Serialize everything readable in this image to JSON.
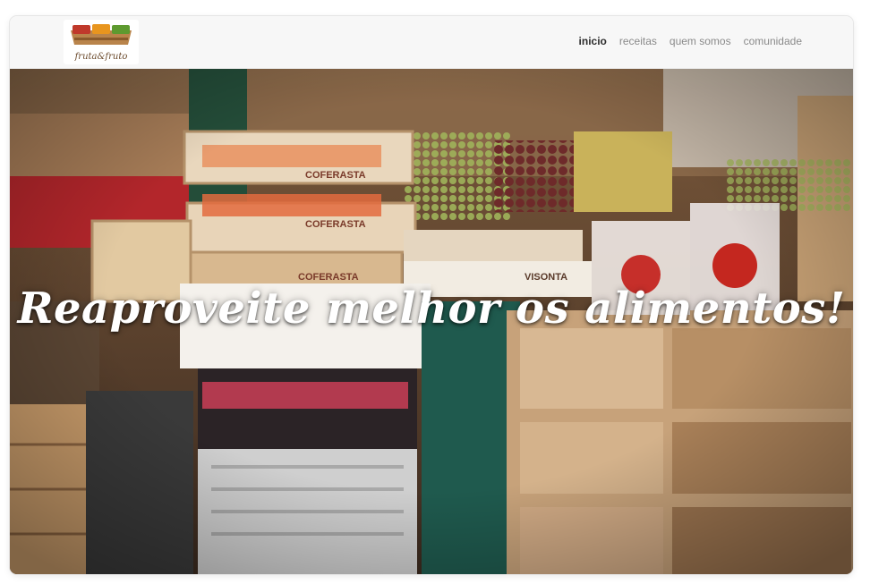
{
  "brand": {
    "logo_text": "fruta&fruto",
    "colors": {
      "wood": "#b9844b",
      "red": "#c0392b",
      "orange": "#e8951e",
      "green": "#5e9a2f"
    }
  },
  "nav": {
    "items": [
      {
        "label": "inicio",
        "active": true
      },
      {
        "label": "receitas",
        "active": false
      },
      {
        "label": "quem somos",
        "active": false
      },
      {
        "label": "comunidade",
        "active": false
      }
    ]
  },
  "hero": {
    "headline": "Reaproveite melhor os alimentos!",
    "crate_labels": [
      "COFERASTA",
      "COFERASTA",
      "COFERASTA",
      "VISONTA"
    ]
  }
}
